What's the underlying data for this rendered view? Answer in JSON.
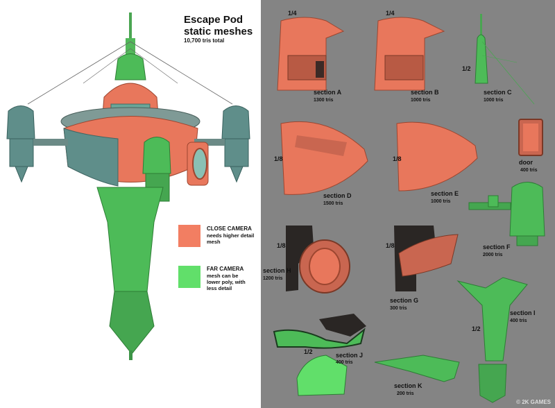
{
  "title": "Escape Pod static meshes",
  "title_line1": "Escape Pod",
  "title_line2": "static meshes",
  "total_tris": "10,700 tris  total",
  "colors": {
    "close": "#f27e62",
    "far": "#61df6a",
    "background_right": "#848484"
  },
  "legend": {
    "close": {
      "head": "CLOSE CAMERA",
      "text1": "needs higher detail",
      "text2": "mesh"
    },
    "far": {
      "head": "FAR CAMERA",
      "text1": "mesh can be",
      "text2": "lower poly, with",
      "text3": "less detail"
    }
  },
  "sections": [
    {
      "label": "section A",
      "tris": "1300  tris",
      "fraction": "1/4"
    },
    {
      "label": "section B",
      "tris": "1000  tris",
      "fraction": "1/4"
    },
    {
      "label": "section C",
      "tris": "1000  tris",
      "fraction": "1/2"
    },
    {
      "label": "section D",
      "tris": "1500  tris",
      "fraction": "1/8"
    },
    {
      "label": "section E",
      "tris": "1000  tris",
      "fraction": "1/8"
    },
    {
      "label": "door",
      "tris": "400  tris"
    },
    {
      "label": "section F",
      "tris": "2000  tris"
    },
    {
      "label": "section H",
      "tris": "1200   tris",
      "fraction": "1/8"
    },
    {
      "label": "section G",
      "tris": "300   tris",
      "fraction": "1/8"
    },
    {
      "label": "section I",
      "tris": "400  tris",
      "fraction": "1/2"
    },
    {
      "label": "section J",
      "tris": "400   tris",
      "fraction": "1/2"
    },
    {
      "label": "section K",
      "tris": "200   tris"
    }
  ],
  "copyright": "© 2K GAMES"
}
